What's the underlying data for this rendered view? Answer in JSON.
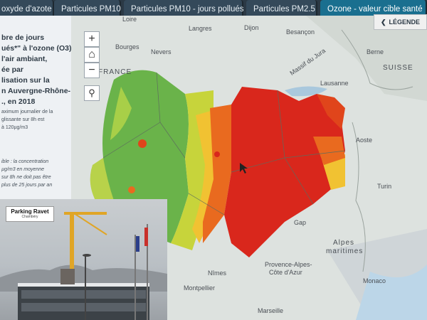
{
  "tabs": [
    {
      "label": "oxyde d'azote"
    },
    {
      "label": "Particules PM10"
    },
    {
      "label": "Particules PM10 - jours pollués"
    },
    {
      "label": "Particules PM2.5"
    },
    {
      "label": "Ozone - valeur cible santé"
    }
  ],
  "panel": {
    "lines": [
      "bre de jours",
      "ués*\" à l'ozone (O3)",
      "l'air ambiant,",
      "ée par",
      "lisation sur la",
      "n Auvergne-Rhône-",
      "., en 2018"
    ],
    "note": [
      "aximum journalier de la",
      "glissante sur 8h est",
      "à 120µg/m3"
    ],
    "note2": [
      "ible : la concentration",
      "µg/m3 en moyenne",
      "sur 8h ne doit pas être",
      "plus de 25 jours par an"
    ]
  },
  "map_controls": {
    "zoom_in": "+",
    "home": "⌂",
    "zoom_out": "−",
    "search": "⚲"
  },
  "legend_button": {
    "chevron": "❮",
    "label": "LÉGENDE"
  },
  "places": [
    {
      "name": "Langres"
    },
    {
      "name": "Dijon"
    },
    {
      "name": "Besançon"
    },
    {
      "name": "Bourges"
    },
    {
      "name": "Nevers"
    },
    {
      "name": "Berne"
    },
    {
      "name": "SUISSE"
    },
    {
      "name": "Massif du Jura"
    },
    {
      "name": "Lausanne"
    },
    {
      "name": "FRANCE"
    },
    {
      "name": "Aoste"
    },
    {
      "name": "Turin"
    },
    {
      "name": "Gap"
    },
    {
      "name": "Alpes"
    },
    {
      "name": "maritimes"
    },
    {
      "name": "Provence-Alpes-"
    },
    {
      "name": "Côte d'Azur"
    },
    {
      "name": "Nîmes"
    },
    {
      "name": "Montpellier"
    },
    {
      "name": "Monaco"
    },
    {
      "name": "Marseille"
    },
    {
      "name": "Loire"
    }
  ],
  "photo": {
    "title": "Parking Ravet",
    "subtitle": "Chambéry"
  },
  "colors": {
    "high": "#d9271c",
    "mid": "#e96a1f",
    "low": "#f1c232",
    "good": "#6ab34a",
    "tab_active": "#1a6f8f"
  }
}
